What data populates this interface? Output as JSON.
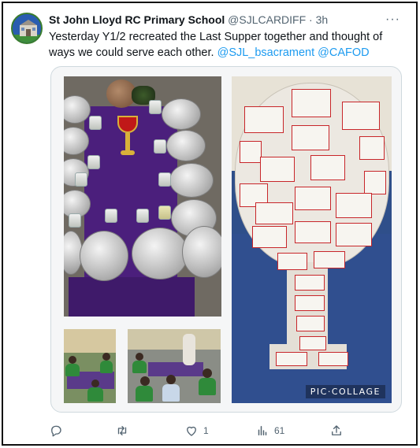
{
  "tweet": {
    "author_name": "St John Lloyd RC Primary School",
    "handle": "@SJLCARDIFF",
    "separator": "·",
    "time": "3h",
    "more_label": "···",
    "text_before": "Yesterday Y1/2 recreated the Last Supper together and thought of ways we could serve each other.",
    "mention_1": "@SJL_bsacrament",
    "mention_2": "@CAFOD"
  },
  "media": {
    "watermark": "PIC·COLLAGE"
  },
  "actions": {
    "reply": {
      "icon": "reply-icon",
      "count": ""
    },
    "retweet": {
      "icon": "retweet-icon",
      "count": ""
    },
    "like": {
      "icon": "heart-icon",
      "count": "1"
    },
    "views": {
      "icon": "views-icon",
      "count": "61"
    },
    "share": {
      "icon": "share-icon",
      "count": ""
    }
  },
  "colors": {
    "link": "#1d9bf0",
    "muted": "#536471",
    "text": "#0f1419"
  }
}
